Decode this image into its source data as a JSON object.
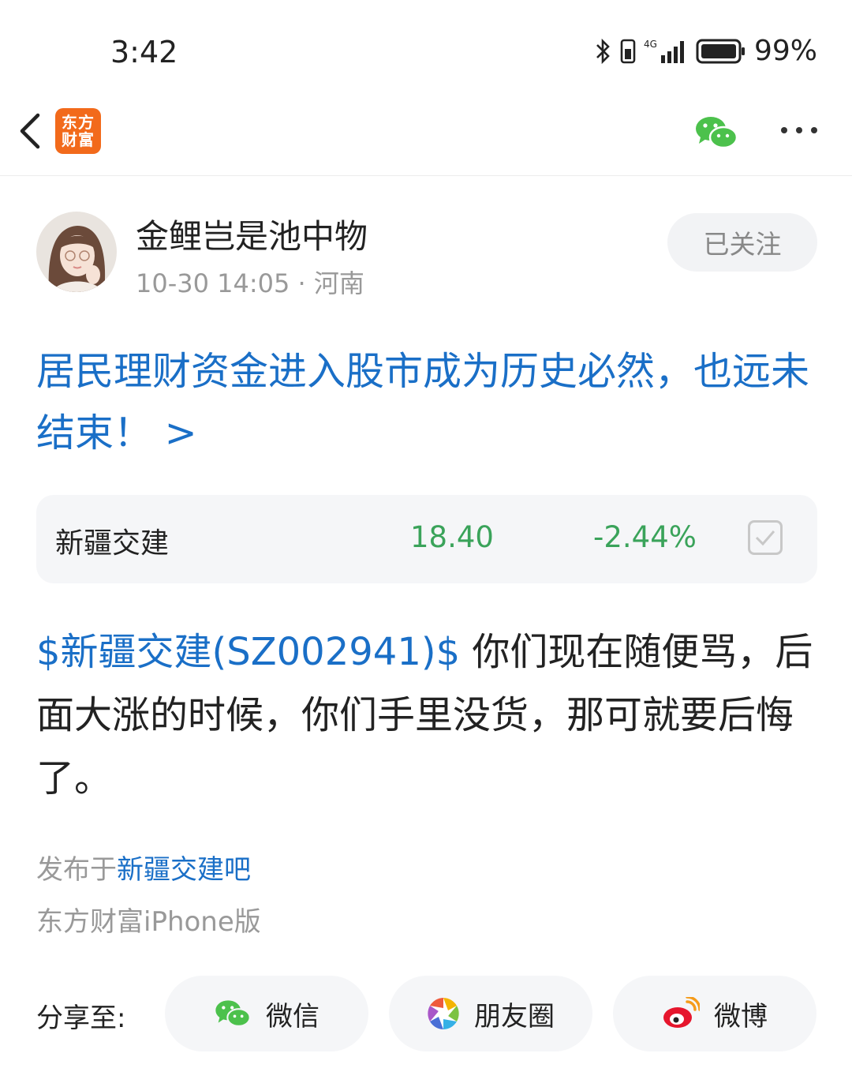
{
  "status_bar": {
    "time": "3:42",
    "network": "4G",
    "battery": "99%"
  },
  "nav": {
    "logo_line1": "东方",
    "logo_line2": "财富"
  },
  "author": {
    "name": "金鲤岂是池中物",
    "meta": "10-30 14:05 · 河南",
    "follow_label": "已关注"
  },
  "post": {
    "title": "居民理财资金进入股市成为历史必然，也远未结束！ >",
    "body_link": "$新疆交建(SZ002941)$",
    "body_text": " 你们现在随便骂，后面大涨的时候，你们手里没货，那可就要后悔了。",
    "published_prefix": "发布于",
    "published_forum": "新疆交建吧",
    "client": "东方财富iPhone版"
  },
  "stock": {
    "name": "新疆交建",
    "price": "18.40",
    "change": "-2.44%"
  },
  "share": {
    "label": "分享至:",
    "wechat": "微信",
    "moments": "朋友圈",
    "weibo": "微博"
  },
  "colors": {
    "link": "#1a6fc7",
    "down": "#3aa35a",
    "brand": "#f26a1b",
    "wechat": "#4cc14c",
    "weibo": "#e6162d"
  }
}
